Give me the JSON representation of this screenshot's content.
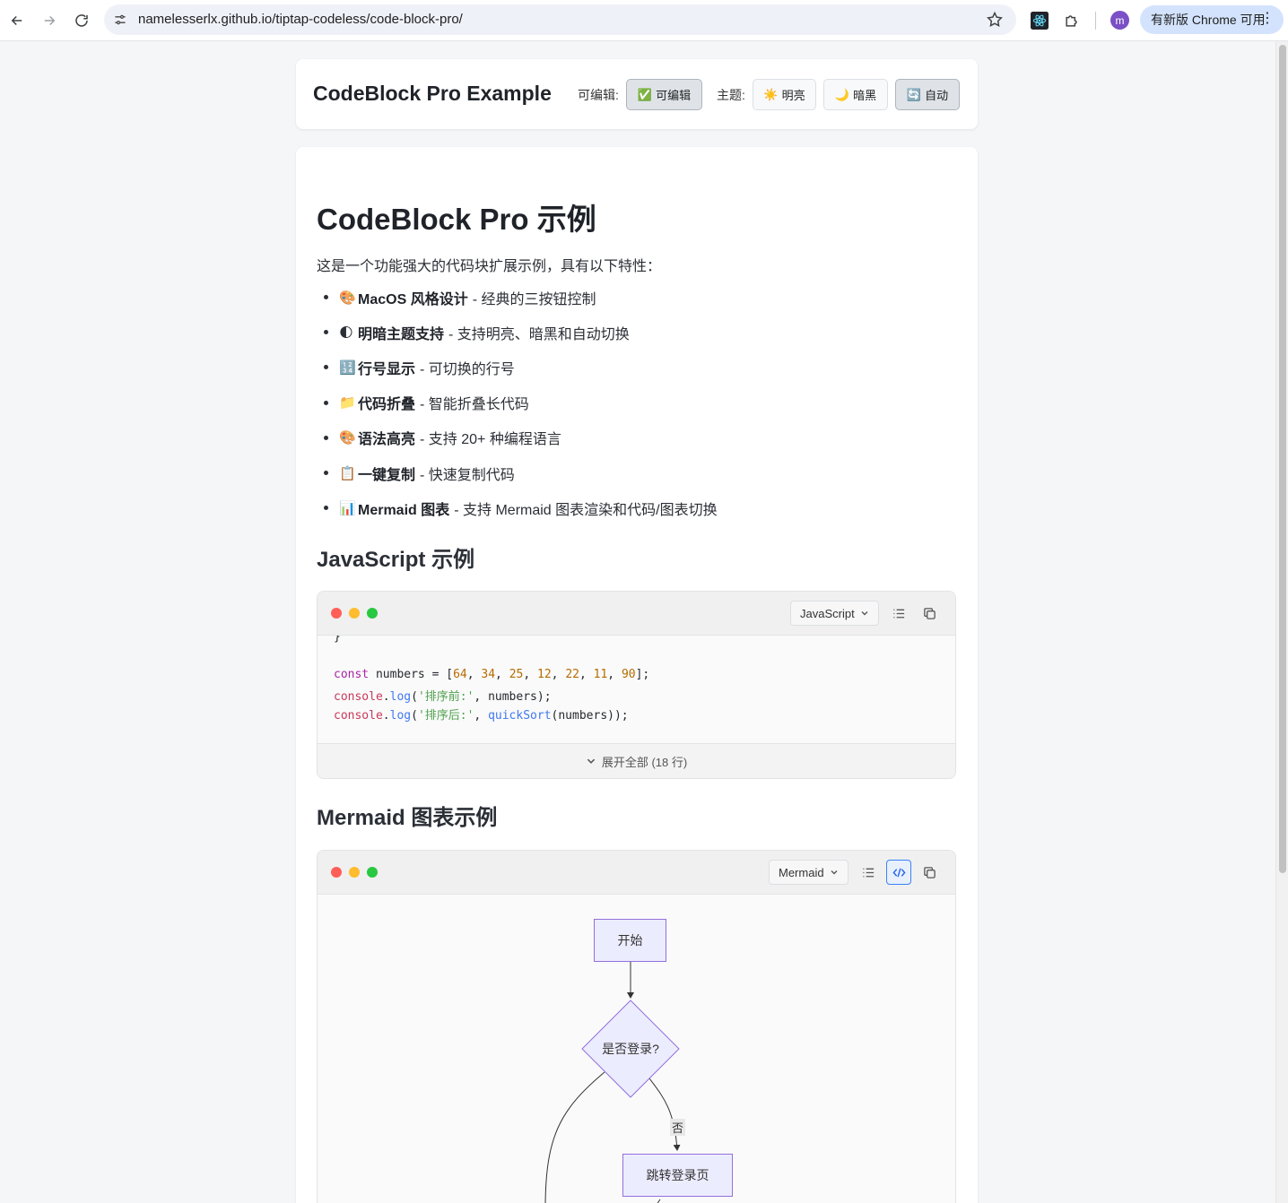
{
  "browser": {
    "url": "namelesserlx.github.io/tiptap-codeless/code-block-pro/",
    "avatar_letter": "m",
    "update_label": "有新版 Chrome 可用"
  },
  "header": {
    "title": "CodeBlock Pro Example",
    "editable_label": "可编辑:",
    "editable_button": "可编辑",
    "editable_icon": "✅",
    "theme_label": "主题:",
    "theme_buttons": [
      {
        "icon": "☀️",
        "label": "明亮",
        "active": false
      },
      {
        "icon": "🌙",
        "label": "暗黑",
        "active": false
      },
      {
        "icon": "🔄",
        "label": "自动",
        "active": true
      }
    ]
  },
  "content": {
    "title": "CodeBlock Pro 示例",
    "intro": "这是一个功能强大的代码块扩展示例，具有以下特性：",
    "features": [
      {
        "icon": "🎨",
        "title": "MacOS 风格设计",
        "desc": "- 经典的三按钮控制"
      },
      {
        "icon": "🌓",
        "title": "明暗主题支持",
        "desc": "- 支持明亮、暗黑和自动切换"
      },
      {
        "icon": "🔢",
        "title": "行号显示",
        "desc": "- 可切换的行号"
      },
      {
        "icon": "📁",
        "title": "代码折叠",
        "desc": "- 智能折叠长代码"
      },
      {
        "icon": "🎨",
        "title": "语法高亮",
        "desc": "- 支持 20+ 种编程语言"
      },
      {
        "icon": "📋",
        "title": "一键复制",
        "desc": "- 快速复制代码"
      },
      {
        "icon": "📊",
        "title": "Mermaid 图表",
        "desc": "- 支持 Mermaid 图表渲染和代码/图表切换"
      }
    ],
    "js_heading": "JavaScript 示例",
    "js_block": {
      "language": "JavaScript",
      "code": {
        "brace": "}",
        "line1_kw": "const",
        "line1_var": " numbers = [",
        "nums": [
          "64",
          "34",
          "25",
          "12",
          "22",
          "11",
          "90"
        ],
        "line2_obj": "console",
        "line2_fn": "log",
        "line2_str": "'排序前:'",
        "line2_rest": ", numbers);",
        "line3_str": "'排序后:'",
        "line3_fn2": "quickSort",
        "line3_rest": "(numbers));"
      },
      "expand_label": "展开全部 (18 行)"
    },
    "mermaid_heading": "Mermaid 图表示例",
    "mermaid_block": {
      "language": "Mermaid",
      "nodes": {
        "start": "开始",
        "decision": "是否登录?",
        "login": "跳转登录页"
      },
      "edge_no": "否"
    }
  },
  "colors": {
    "accent": "#2563eb",
    "traffic_red": "#ff5f57",
    "traffic_yellow": "#febc2e",
    "traffic_green": "#28c840",
    "mermaid_node_fill": "#ececff",
    "mermaid_node_stroke": "#9370db"
  }
}
